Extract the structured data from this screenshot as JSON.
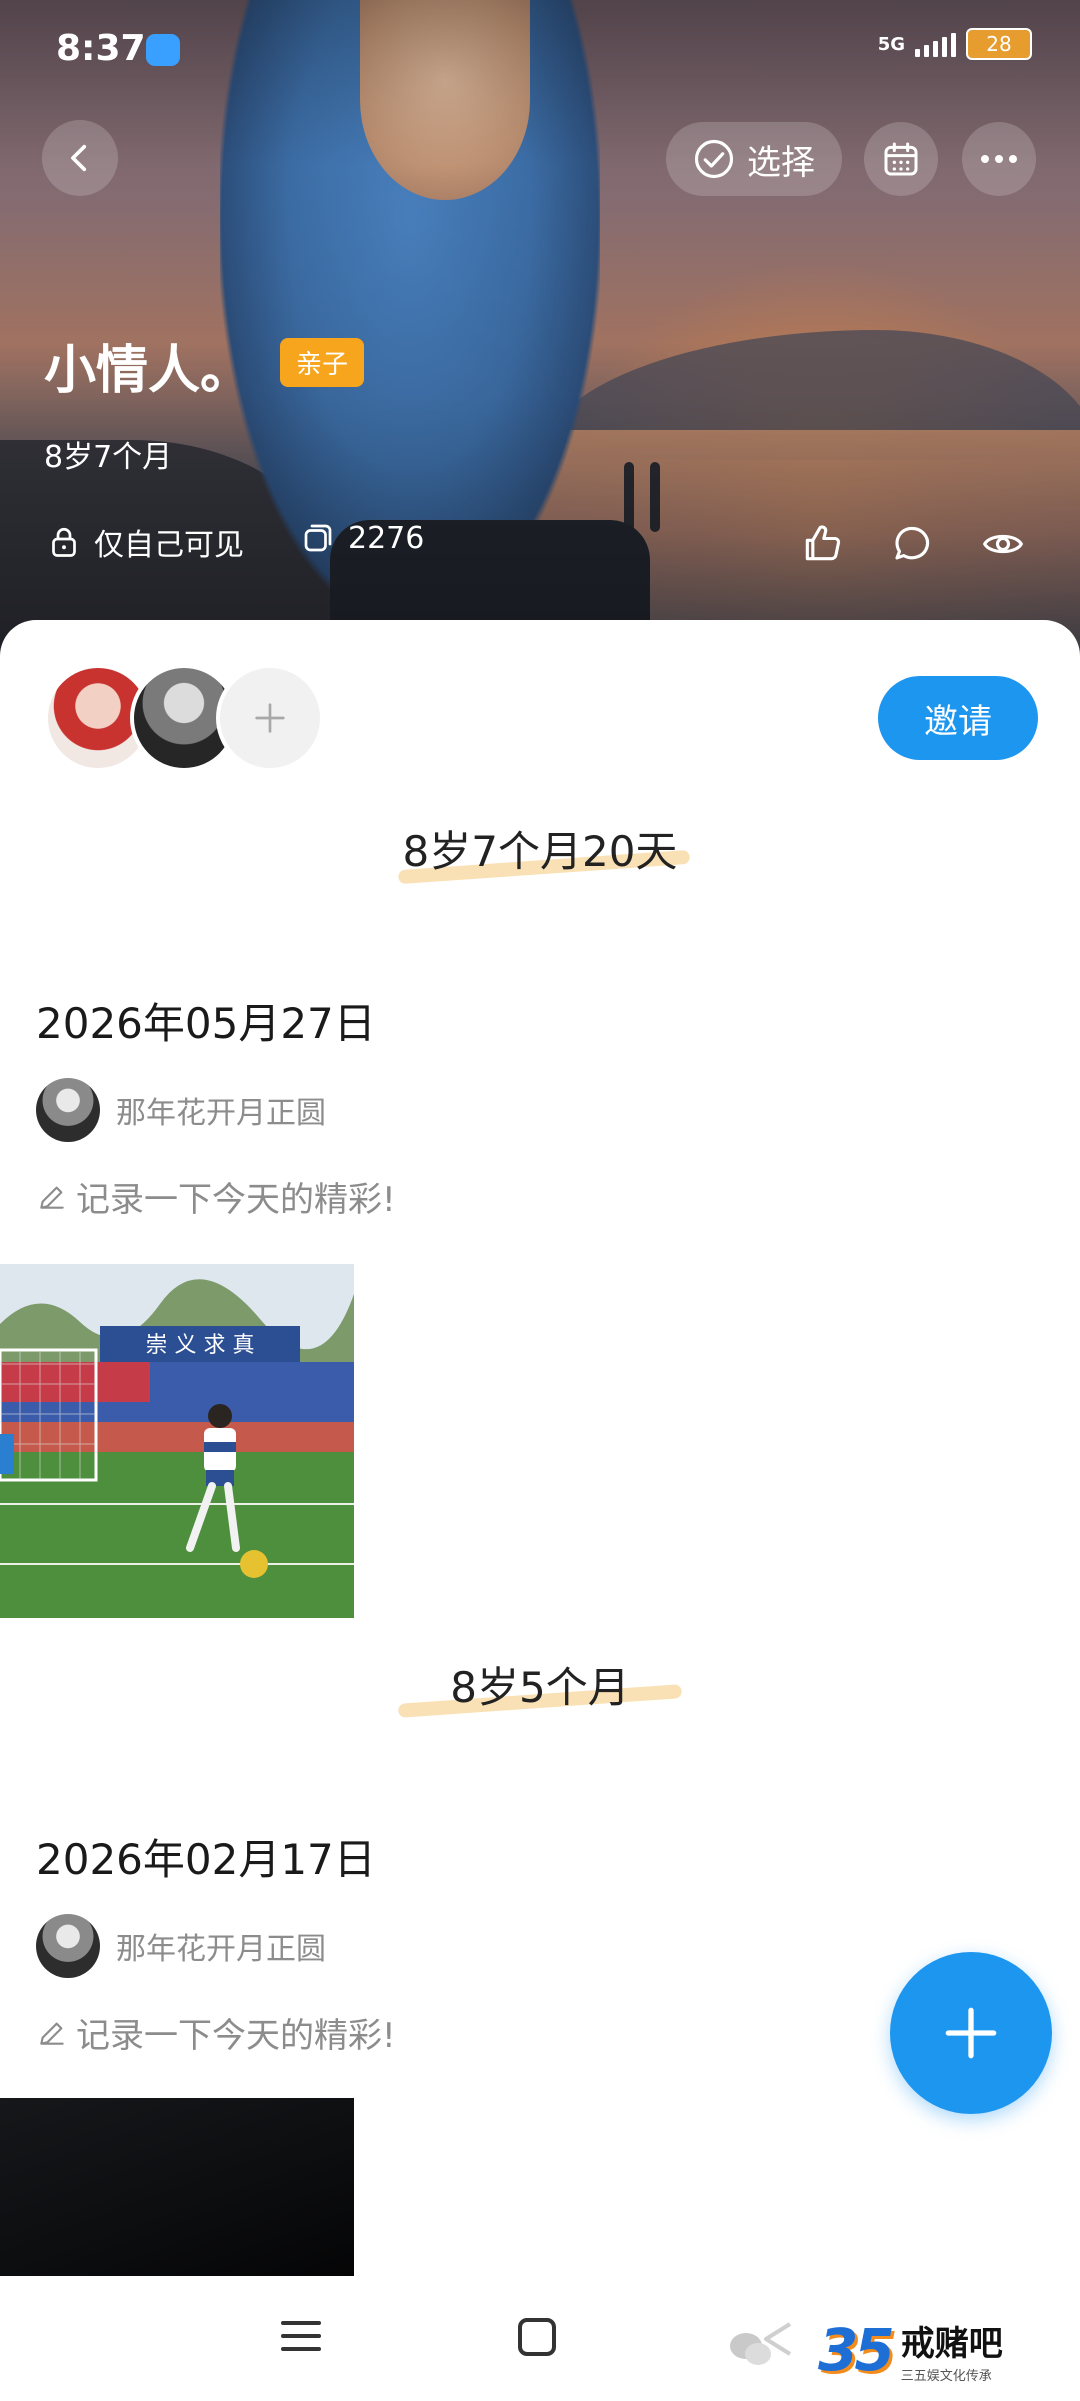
{
  "status_bar": {
    "time": "8:37",
    "network": "5G",
    "battery": "28"
  },
  "header": {
    "select_label": "选择",
    "album_title": "小情人。",
    "tag": "亲子",
    "age": "8岁7个月",
    "privacy": "仅自己可见",
    "count": "2276"
  },
  "invite_label": "邀请",
  "timeline": [
    {
      "milestone": "8岁7个月20天",
      "date": "2026年05月27日",
      "author": "那年花开月正圆",
      "note": "记录一下今天的精彩!",
      "photo_banner": "崇 义 求 真"
    },
    {
      "milestone": "8岁5个月",
      "date": "2026年02月17日",
      "author": "那年花开月正圆",
      "note": "记录一下今天的精彩!"
    }
  ],
  "watermark": {
    "number": "35",
    "brand": "戒赌吧",
    "subtitle": "三五娱文化传承"
  },
  "colors": {
    "accent": "#1d96f0",
    "tag": "#f7a51c"
  }
}
